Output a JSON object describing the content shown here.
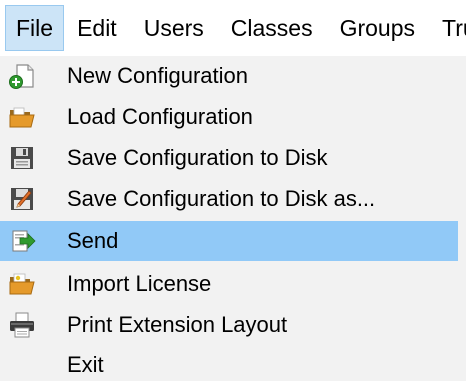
{
  "menubar": {
    "items": [
      "File",
      "Edit",
      "Users",
      "Classes",
      "Groups",
      "Tru"
    ]
  },
  "menu": {
    "items": [
      {
        "label": "New Configuration",
        "icon": "new-document-icon"
      },
      {
        "label": "Load Configuration",
        "icon": "folder-open-icon"
      },
      {
        "label": "Save Configuration to Disk",
        "icon": "floppy-disk-icon"
      },
      {
        "label": "Save Configuration to Disk as...",
        "icon": "floppy-disk-pencil-icon"
      },
      {
        "label": "Send",
        "icon": "send-arrow-icon",
        "selected": true
      },
      {
        "label": "Import License",
        "icon": "import-license-icon"
      },
      {
        "label": "Print Extension Layout",
        "icon": "printer-icon"
      },
      {
        "label": "Exit",
        "icon": ""
      }
    ]
  },
  "colors": {
    "selection": "#91c9f7",
    "active_menu": "#cce4f7",
    "menu_bg": "#f2f2f2"
  }
}
